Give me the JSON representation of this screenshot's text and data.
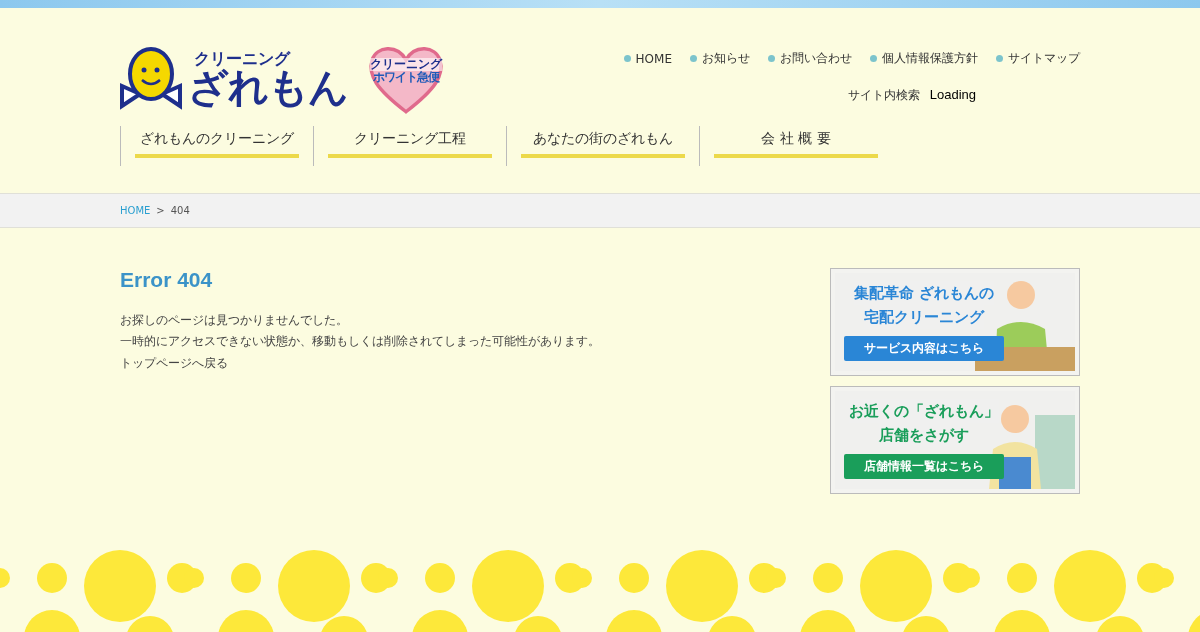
{
  "logo": {
    "small": "クリーニング",
    "main": "ざれもん",
    "badge_small": "クリーニング",
    "badge_main": "ホワイト急便"
  },
  "top_links": [
    {
      "label": "HOME"
    },
    {
      "label": "お知らせ"
    },
    {
      "label": "お問い合わせ"
    },
    {
      "label": "個人情報保護方針"
    },
    {
      "label": "サイトマップ"
    }
  ],
  "site_search": {
    "label": "サイト内検索",
    "status": "Loading"
  },
  "main_nav": [
    {
      "label": "ざれもんのクリーニング"
    },
    {
      "label": "クリーニング工程"
    },
    {
      "label": "あなたの街のざれもん"
    },
    {
      "label": "会 社 概 要"
    }
  ],
  "breadcrumb": [
    {
      "label": "HOME",
      "link": true
    },
    {
      "label": "404",
      "link": false
    }
  ],
  "breadcrumb_separator": ">",
  "content": {
    "title": "Error 404",
    "lines": [
      "お探しのページは見つかりませんでした。",
      "一時的にアクセスできない状態か、移動もしくは削除されてしまった可能性があります。"
    ],
    "back_link": "トップページへ戻る"
  },
  "banners": [
    {
      "kind": "delivery",
      "headline": [
        "集配革命 ざれもんの",
        "宅配クリーニング"
      ],
      "button": "サービス内容はこちら",
      "color": "#2a86d6"
    },
    {
      "kind": "store",
      "headline": [
        "お近くの「ざれもん」",
        "店舗をさがす"
      ],
      "button": "店舗情報一覧はこちら",
      "color": "#1a9e5a"
    }
  ]
}
